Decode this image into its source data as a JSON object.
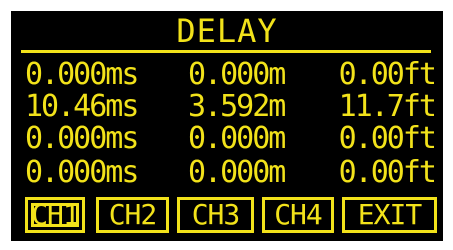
{
  "screen": {
    "title": "DELAY",
    "colors": {
      "background": "#000000",
      "foreground": "#f2e21a",
      "frame": "#ffffff"
    }
  },
  "rows": [
    {
      "ms": "0.000ms",
      "m": "0.000m",
      "ft": "0.00ft"
    },
    {
      "ms": "10.46ms",
      "m": "3.592m",
      "ft": "11.7ft"
    },
    {
      "ms": "0.000ms",
      "m": "0.000m",
      "ft": "0.00ft"
    },
    {
      "ms": "0.000ms",
      "m": "0.000m",
      "ft": "0.00ft"
    }
  ],
  "buttons": {
    "ch1": "CH1",
    "ch2": "CH2",
    "ch3": "CH3",
    "ch4": "CH4",
    "exit": "EXIT",
    "selected": "CH1"
  }
}
